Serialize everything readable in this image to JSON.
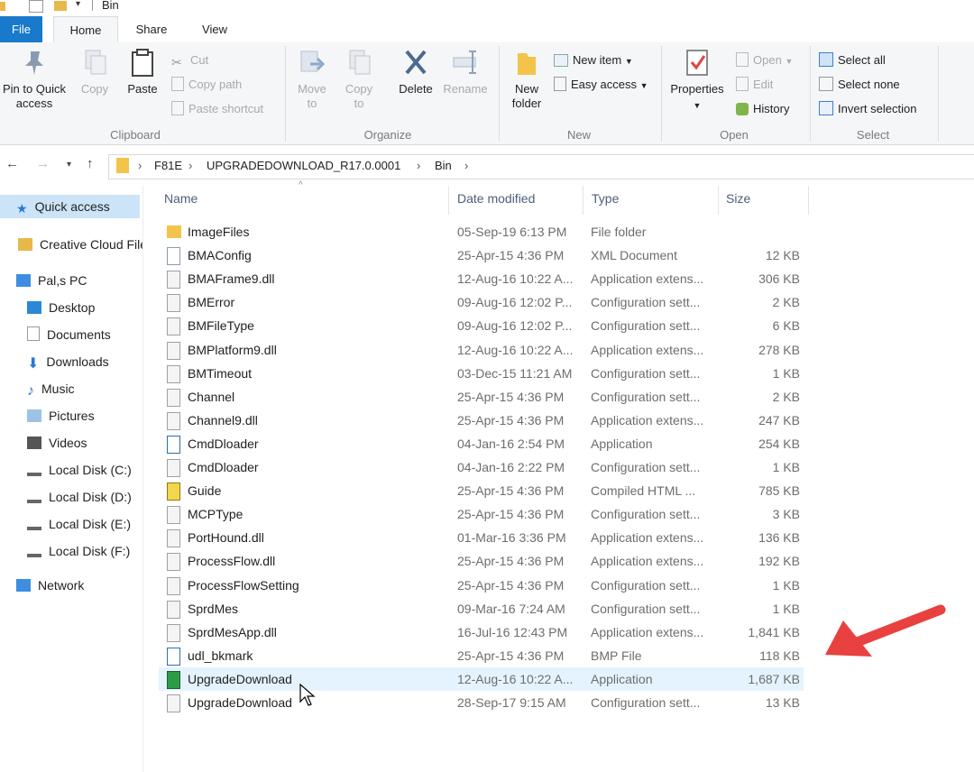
{
  "window": {
    "title": "Bin"
  },
  "tabs": [
    "File",
    "Home",
    "Share",
    "View"
  ],
  "ribbon": {
    "clipboard": {
      "label": "Clipboard",
      "pin": "Pin to Quick access",
      "copy": "Copy",
      "paste": "Paste",
      "cut": "Cut",
      "copy_path": "Copy path",
      "paste_shortcut": "Paste shortcut"
    },
    "organize": {
      "label": "Organize",
      "move_to": "Move to",
      "copy_to": "Copy to",
      "delete": "Delete",
      "rename": "Rename"
    },
    "new": {
      "label": "New",
      "new_folder": "New folder",
      "new_item": "New item",
      "easy_access": "Easy access"
    },
    "open": {
      "label": "Open",
      "properties": "Properties",
      "open": "Open",
      "edit": "Edit",
      "history": "History"
    },
    "select": {
      "label": "Select",
      "select_all": "Select all",
      "select_none": "Select none",
      "invert": "Invert selection"
    }
  },
  "breadcrumb": [
    "F81E",
    "UPGRADEDOWNLOAD_R17.0.0001",
    "Bin"
  ],
  "sidebar": [
    {
      "label": "Quick access",
      "icon": "star-icon"
    },
    {
      "label": "Creative Cloud Files",
      "icon": "creative-cloud-icon"
    },
    {
      "label": "Pal,s  PC",
      "icon": "computer-icon"
    },
    {
      "label": "Desktop",
      "icon": "desktop-icon"
    },
    {
      "label": "Documents",
      "icon": "documents-icon"
    },
    {
      "label": "Downloads",
      "icon": "downloads-icon"
    },
    {
      "label": "Music",
      "icon": "music-icon"
    },
    {
      "label": "Pictures",
      "icon": "pictures-icon"
    },
    {
      "label": "Videos",
      "icon": "videos-icon"
    },
    {
      "label": "Local Disk (C:)",
      "icon": "drive-c-icon"
    },
    {
      "label": "Local Disk (D:)",
      "icon": "drive-icon"
    },
    {
      "label": "Local Disk (E:)",
      "icon": "drive-icon"
    },
    {
      "label": "Local Disk (F:)",
      "icon": "drive-icon"
    },
    {
      "label": "Network",
      "icon": "network-icon"
    }
  ],
  "columns": {
    "name": "Name",
    "date": "Date modified",
    "type": "Type",
    "size": "Size"
  },
  "files": [
    {
      "name": "ImageFiles",
      "date": "05-Sep-19 6:13 PM",
      "type": "File folder",
      "size": "",
      "icon": "folder-icon"
    },
    {
      "name": "BMAConfig",
      "date": "25-Apr-15 4:36 PM",
      "type": "XML Document",
      "size": "12 KB",
      "icon": "xml-file-icon"
    },
    {
      "name": "BMAFrame9.dll",
      "date": "12-Aug-16 10:22 A...",
      "type": "Application extens...",
      "size": "306 KB",
      "icon": "dll-file-icon"
    },
    {
      "name": "BMError",
      "date": "09-Aug-16 12:02 P...",
      "type": "Configuration sett...",
      "size": "2 KB",
      "icon": "config-file-icon"
    },
    {
      "name": "BMFileType",
      "date": "09-Aug-16 12:02 P...",
      "type": "Configuration sett...",
      "size": "6 KB",
      "icon": "config-file-icon"
    },
    {
      "name": "BMPlatform9.dll",
      "date": "12-Aug-16 10:22 A...",
      "type": "Application extens...",
      "size": "278 KB",
      "icon": "dll-file-icon"
    },
    {
      "name": "BMTimeout",
      "date": "03-Dec-15 11:21 AM",
      "type": "Configuration sett...",
      "size": "1 KB",
      "icon": "config-file-icon"
    },
    {
      "name": "Channel",
      "date": "25-Apr-15 4:36 PM",
      "type": "Configuration sett...",
      "size": "2 KB",
      "icon": "config-file-icon"
    },
    {
      "name": "Channel9.dll",
      "date": "25-Apr-15 4:36 PM",
      "type": "Application extens...",
      "size": "247 KB",
      "icon": "dll-file-icon"
    },
    {
      "name": "CmdDloader",
      "date": "04-Jan-16 2:54 PM",
      "type": "Application",
      "size": "254 KB",
      "icon": "application-icon"
    },
    {
      "name": "CmdDloader",
      "date": "04-Jan-16 2:22 PM",
      "type": "Configuration sett...",
      "size": "1 KB",
      "icon": "config-file-icon"
    },
    {
      "name": "Guide",
      "date": "25-Apr-15 4:36 PM",
      "type": "Compiled HTML ...",
      "size": "785 KB",
      "icon": "help-file-icon"
    },
    {
      "name": "MCPType",
      "date": "25-Apr-15 4:36 PM",
      "type": "Configuration sett...",
      "size": "3 KB",
      "icon": "config-file-icon"
    },
    {
      "name": "PortHound.dll",
      "date": "01-Mar-16 3:36 PM",
      "type": "Application extens...",
      "size": "136 KB",
      "icon": "dll-file-icon"
    },
    {
      "name": "ProcessFlow.dll",
      "date": "25-Apr-15 4:36 PM",
      "type": "Application extens...",
      "size": "192 KB",
      "icon": "dll-file-icon"
    },
    {
      "name": "ProcessFlowSetting",
      "date": "25-Apr-15 4:36 PM",
      "type": "Configuration sett...",
      "size": "1 KB",
      "icon": "config-file-icon"
    },
    {
      "name": "SprdMes",
      "date": "09-Mar-16 7:24 AM",
      "type": "Configuration sett...",
      "size": "1 KB",
      "icon": "config-file-icon"
    },
    {
      "name": "SprdMesApp.dll",
      "date": "16-Jul-16 12:43 PM",
      "type": "Application extens...",
      "size": "1,841 KB",
      "icon": "dll-file-icon"
    },
    {
      "name": "udl_bkmark",
      "date": "25-Apr-15 4:36 PM",
      "type": "BMP File",
      "size": "118 KB",
      "icon": "bmp-file-icon"
    },
    {
      "name": "UpgradeDownload",
      "date": "12-Aug-16 10:22 A...",
      "type": "Application",
      "size": "1,687 KB",
      "icon": "upgrade-app-icon",
      "hover": true
    },
    {
      "name": "UpgradeDownload",
      "date": "28-Sep-17 9:15 AM",
      "type": "Configuration sett...",
      "size": "13 KB",
      "icon": "config-file-icon"
    }
  ],
  "annotation": {
    "arrow_color": "#e8413f"
  }
}
